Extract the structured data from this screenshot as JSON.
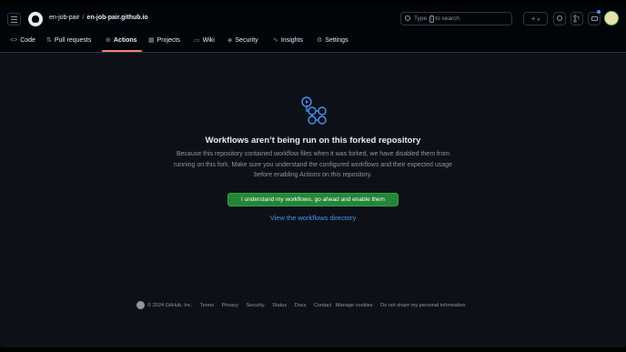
{
  "header": {
    "owner": "en-job-pair",
    "separator": "/",
    "repo": "en-job-pair.github.io",
    "search": {
      "prefix": "Type",
      "key": "/",
      "suffix": "to search"
    },
    "new_button_label": "+",
    "new_dropdown_icon": "chevron-down-icon"
  },
  "nav": {
    "tabs": [
      {
        "label": "Code",
        "icon": "code-icon"
      },
      {
        "label": "Pull requests",
        "icon": "pull-request-icon"
      },
      {
        "label": "Actions",
        "icon": "play-icon",
        "active": true
      },
      {
        "label": "Projects",
        "icon": "table-icon"
      },
      {
        "label": "Wiki",
        "icon": "book-icon"
      },
      {
        "label": "Security",
        "icon": "shield-icon"
      },
      {
        "label": "Insights",
        "icon": "graph-icon"
      },
      {
        "label": "Settings",
        "icon": "gear-icon"
      }
    ]
  },
  "main": {
    "title": "Workflows aren’t being run on this forked repository",
    "description": "Because this repository contained workflow files when it was forked, we have disabled them from running on this fork. Make sure you understand the configured workflows and their expected usage before enabling Actions on this repository.",
    "enable_button": "I understand my workflows, go ahead and enable them",
    "directory_link": "View the workflows directory"
  },
  "footer": {
    "copyright": "© 2024 GitHub, Inc.",
    "links": [
      "Terms",
      "Privacy",
      "Security",
      "Status",
      "Docs",
      "Contact",
      "Manage cookies",
      "Do not share my personal information"
    ]
  },
  "colors": {
    "background": "#0d1117",
    "header": "#010409",
    "accent_underline": "#f78166",
    "button_green": "#238636",
    "link_blue": "#4493f8"
  }
}
